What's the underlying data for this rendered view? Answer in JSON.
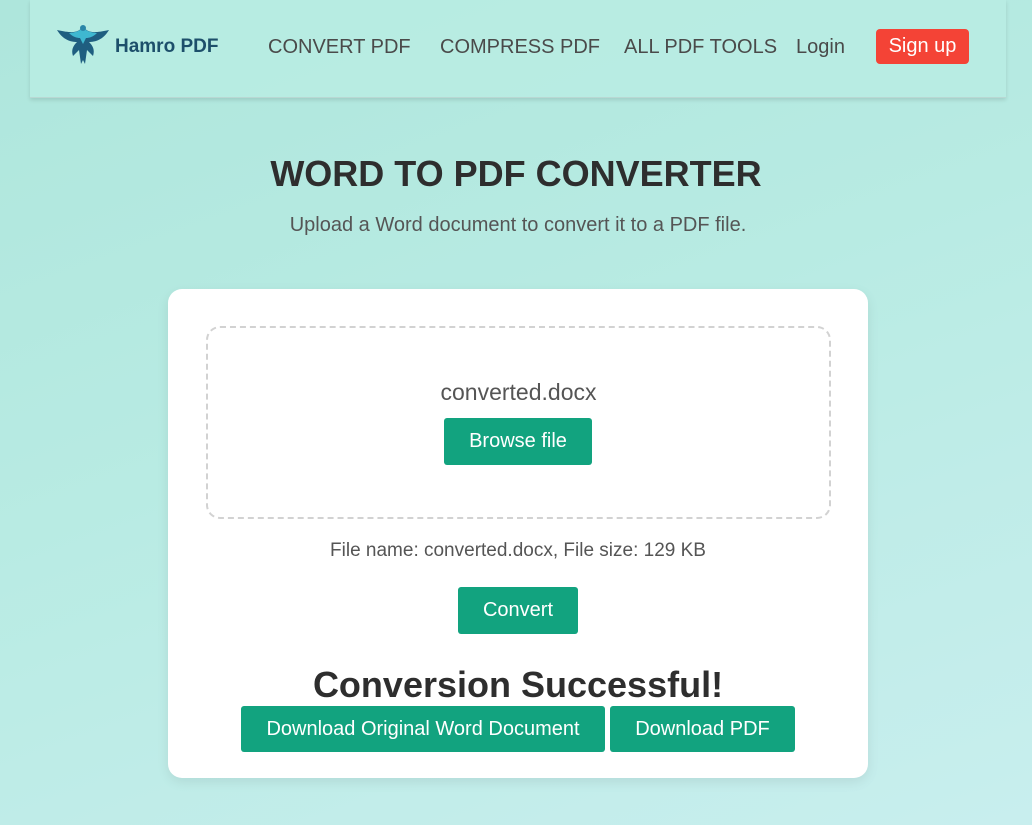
{
  "brand": {
    "name": "Hamro PDF",
    "logo_icon": "phoenix-bird-icon"
  },
  "nav": {
    "items": [
      "CONVERT PDF",
      "COMPRESS PDF",
      "ALL PDF TOOLS"
    ],
    "login": "Login",
    "signup": "Sign up"
  },
  "page": {
    "title": "WORD TO PDF CONVERTER",
    "subtitle": "Upload a Word document to convert it to a PDF file."
  },
  "upload": {
    "selected_file": "converted.docx",
    "browse_label": "Browse file",
    "file_info": "File name: converted.docx, File size: 129 KB",
    "convert_label": "Convert"
  },
  "result": {
    "message": "Conversion Successful!",
    "download_original_label": "Download Original Word Document",
    "download_pdf_label": "Download PDF"
  },
  "colors": {
    "accent": "#12a37f",
    "signup": "#f44336",
    "background": "#b8ebe3"
  }
}
